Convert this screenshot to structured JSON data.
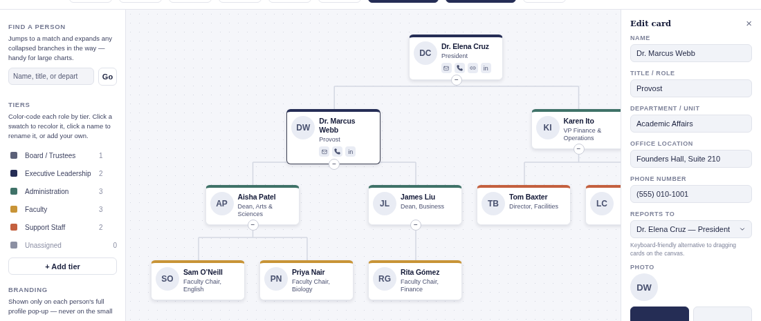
{
  "toolbar": {
    "buttons": [
      {
        "kind": "outline"
      },
      {
        "kind": "outline"
      },
      {
        "kind": "outline"
      },
      {
        "kind": "outline"
      },
      {
        "kind": "outline"
      },
      {
        "kind": "outline"
      },
      {
        "kind": "primary"
      },
      {
        "kind": "primary"
      },
      {
        "kind": "outline"
      }
    ]
  },
  "sidebar": {
    "find": {
      "heading": "FIND A PERSON",
      "description": "Jumps to a match and expands any collapsed branches in the way — handy for large charts.",
      "placeholder": "Name, title, or depart",
      "button": "Go"
    },
    "tiers": {
      "heading": "TIERS",
      "description": "Color-code each role by tier. Click a swatch to recolor it, click a name to rename it, or add your own.",
      "items": [
        {
          "name": "Board / Trustees",
          "count": "1",
          "color": "#5b6078",
          "dimmed": false
        },
        {
          "name": "Executive Leadership",
          "count": "2",
          "color": "#252d55",
          "dimmed": false
        },
        {
          "name": "Administration",
          "count": "3",
          "color": "#3f7268",
          "dimmed": false
        },
        {
          "name": "Faculty",
          "count": "3",
          "color": "#c89437",
          "dimmed": false
        },
        {
          "name": "Support Staff",
          "count": "2",
          "color": "#c4603f",
          "dimmed": false
        },
        {
          "name": "Unassigned",
          "count": "0",
          "color": "#8c90a3",
          "dimmed": true
        }
      ],
      "add_button": "+ Add tier"
    },
    "branding": {
      "heading": "BRANDING",
      "description": "Shown only on each person's full profile pop-up — never on the small"
    }
  },
  "chart": {
    "root": {
      "initials": "DC",
      "name": "Dr. Elena Cruz",
      "title": "President",
      "color": "#252d55",
      "selected": false,
      "expanded": true,
      "toggle": "−",
      "links": [
        {
          "kind": "mail"
        },
        {
          "kind": "phone"
        },
        {
          "kind": "link"
        },
        {
          "kind": "linkedin",
          "label": "in"
        }
      ],
      "children": [
        {
          "initials": "DW",
          "name": "Dr. Marcus Webb",
          "title": "Provost",
          "color": "#252d55",
          "selected": true,
          "expanded": true,
          "toggle": "−",
          "links": [
            {
              "kind": "mail"
            },
            {
              "kind": "phone"
            },
            {
              "kind": "linkedin",
              "label": "in"
            }
          ],
          "children": [
            {
              "initials": "AP",
              "name": "Aisha Patel",
              "title": "Dean, Arts & Sciences",
              "color": "#3f7268",
              "selected": false,
              "expanded": true,
              "toggle": "−",
              "children": [
                {
                  "initials": "SO",
                  "name": "Sam O’Neill",
                  "title": "Faculty Chair, English",
                  "color": "#c89437",
                  "selected": false
                },
                {
                  "initials": "PN",
                  "name": "Priya Nair",
                  "title": "Faculty Chair, Biology",
                  "color": "#c89437",
                  "selected": false
                }
              ]
            },
            {
              "initials": "JL",
              "name": "James Liu",
              "title": "Dean, Business",
              "color": "#3f7268",
              "selected": false,
              "expanded": true,
              "toggle": "−",
              "children": [
                {
                  "initials": "RG",
                  "name": "Rita Gómez",
                  "title": "Faculty Chair, Finance",
                  "color": "#c89437",
                  "selected": false
                }
              ]
            }
          ]
        },
        {
          "initials": "KI",
          "name": "Karen Ito",
          "title": "VP Finance & Operations",
          "color": "#3f7268",
          "selected": false,
          "expanded": true,
          "toggle": "−",
          "children": [
            {
              "initials": "TB",
              "name": "Tom Baxter",
              "title": "Director, Facilities",
              "color": "#c4603f",
              "selected": false
            },
            {
              "initials": "LC",
              "color": "#c4603f",
              "selected": false
            }
          ]
        }
      ]
    }
  },
  "panel": {
    "title": "Edit card",
    "close": "×",
    "fields": [
      {
        "label": "NAME",
        "value": "Dr. Marcus Webb",
        "kind": "text"
      },
      {
        "label": "TITLE / ROLE",
        "value": "Provost",
        "kind": "text"
      },
      {
        "label": "DEPARTMENT / UNIT",
        "value": "Academic Affairs",
        "kind": "text"
      },
      {
        "label": "OFFICE LOCATION",
        "value": "Founders Hall, Suite 210",
        "kind": "text"
      },
      {
        "label": "PHONE NUMBER",
        "value": "(555) 010-1001",
        "kind": "text"
      },
      {
        "label": "REPORTS TO",
        "value": "Dr. Elena Cruz — President",
        "kind": "select",
        "hint": "Keyboard-friendly alternative to dragging cards on the canvas."
      }
    ],
    "photo": {
      "label": "PHOTO",
      "initials": "DW"
    },
    "buttons": [
      {
        "kind": "primary"
      },
      {
        "kind": "outline"
      }
    ]
  }
}
